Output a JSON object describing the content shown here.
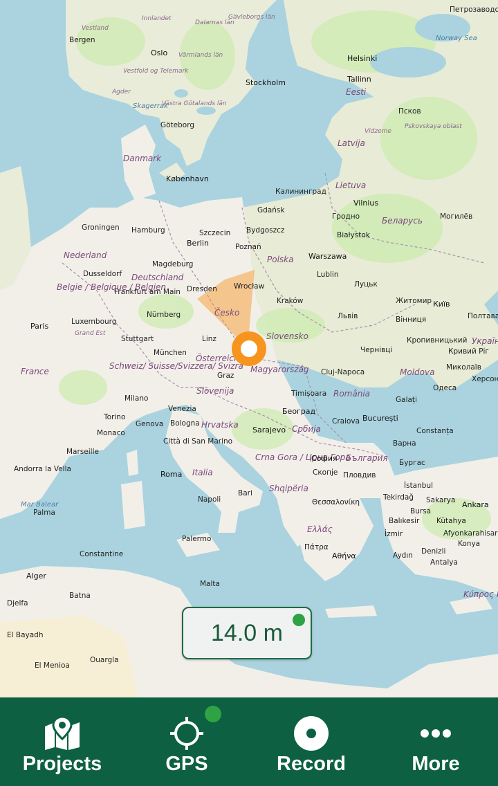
{
  "accuracy": {
    "value": "14.0 m",
    "status_color": "#2ea244"
  },
  "nav": {
    "projects": {
      "label": "Projects",
      "icon": "map-pin-icon"
    },
    "gps": {
      "label": "GPS",
      "icon": "crosshair-icon",
      "status_color": "#2ea244"
    },
    "record": {
      "label": "Record",
      "icon": "record-icon"
    },
    "more": {
      "label": "More",
      "icon": "more-dots-icon"
    }
  },
  "colors": {
    "bar": "#0d6142",
    "marker": "#f7941e",
    "water": "#aad3df",
    "land": "#f2efe9"
  },
  "map": {
    "labels": [
      {
        "t": "Петрозаводск",
        "c": "city"
      },
      {
        "t": "Vestland",
        "c": "region"
      },
      {
        "t": "Innlandet",
        "c": "region"
      },
      {
        "t": "Dalarnas län",
        "c": "region"
      },
      {
        "t": "Gävleborgs län",
        "c": "region"
      },
      {
        "t": "Bergen",
        "c": "city"
      },
      {
        "t": "Oslo",
        "c": "cap"
      },
      {
        "t": "Värmlands län",
        "c": "region"
      },
      {
        "t": "Helsinki",
        "c": "cap"
      },
      {
        "t": "Vestfold og Telemark",
        "c": "region"
      },
      {
        "t": "Stockholm",
        "c": "cap"
      },
      {
        "t": "Tallinn",
        "c": "cap"
      },
      {
        "t": "Agder",
        "c": "region"
      },
      {
        "t": "Eesti",
        "c": "country"
      },
      {
        "t": "Skagerrak",
        "c": "sea"
      },
      {
        "t": "Västra Götalands län",
        "c": "region"
      },
      {
        "t": "Псков",
        "c": "city"
      },
      {
        "t": "Göteborg",
        "c": "city"
      },
      {
        "t": "Vidzeme",
        "c": "region"
      },
      {
        "t": "Latvija",
        "c": "country"
      },
      {
        "t": "Danmark",
        "c": "country"
      },
      {
        "t": "København",
        "c": "cap"
      },
      {
        "t": "Lietuva",
        "c": "country"
      },
      {
        "t": "Калининград",
        "c": "city"
      },
      {
        "t": "Vilnius",
        "c": "cap"
      },
      {
        "t": "Gdańsk",
        "c": "city"
      },
      {
        "t": "Groningen",
        "c": "city"
      },
      {
        "t": "Hamburg",
        "c": "city"
      },
      {
        "t": "Szczecin",
        "c": "city"
      },
      {
        "t": "Bydgoszcz",
        "c": "city"
      },
      {
        "t": "Гродно",
        "c": "city"
      },
      {
        "t": "Беларусь",
        "c": "country"
      },
      {
        "t": "Могилёв",
        "c": "city"
      },
      {
        "t": "Berlin",
        "c": "cap"
      },
      {
        "t": "Poznań",
        "c": "city"
      },
      {
        "t": "Białystok",
        "c": "city"
      },
      {
        "t": "Nederland",
        "c": "country"
      },
      {
        "t": "Magdeburg",
        "c": "city"
      },
      {
        "t": "Polska",
        "c": "country"
      },
      {
        "t": "Warszawa",
        "c": "cap"
      },
      {
        "t": "Dusseldorf",
        "c": "city"
      },
      {
        "t": "Deutschland",
        "c": "country"
      },
      {
        "t": "Lublin",
        "c": "city"
      },
      {
        "t": "Belgie / Belgique / Belgien",
        "c": "country"
      },
      {
        "t": "Frankfurt am Main",
        "c": "city"
      },
      {
        "t": "Dresden",
        "c": "city"
      },
      {
        "t": "Wrocław",
        "c": "city"
      },
      {
        "t": "Луцьк",
        "c": "city"
      },
      {
        "t": "Житомир",
        "c": "city"
      },
      {
        "t": "Київ",
        "c": "cap"
      },
      {
        "t": "Česko",
        "c": "country"
      },
      {
        "t": "Kraków",
        "c": "city"
      },
      {
        "t": "Nürnberg",
        "c": "city"
      },
      {
        "t": "Львів",
        "c": "city"
      },
      {
        "t": "Вінниця",
        "c": "city"
      },
      {
        "t": "Полтава",
        "c": "city"
      },
      {
        "t": "Luxembourg",
        "c": "city"
      },
      {
        "t": "Paris",
        "c": "cap"
      },
      {
        "t": "Grand Est",
        "c": "region"
      },
      {
        "t": "Stuttgart",
        "c": "city"
      },
      {
        "t": "Linz",
        "c": "city"
      },
      {
        "t": "Slovensko",
        "c": "country"
      },
      {
        "t": "Кропивницький",
        "c": "city"
      },
      {
        "t": "Україна",
        "c": "country"
      },
      {
        "t": "Чернівці",
        "c": "city"
      },
      {
        "t": "Кривий Ріг",
        "c": "city"
      },
      {
        "t": "München",
        "c": "city"
      },
      {
        "t": "Österreich",
        "c": "country"
      },
      {
        "t": "Magyarország",
        "c": "country"
      },
      {
        "t": "Миколаїв",
        "c": "city"
      },
      {
        "t": "Херсон",
        "c": "city"
      },
      {
        "t": "France",
        "c": "country"
      },
      {
        "t": "Schweiz/ Suisse/Svizzera/ Svizra",
        "c": "country"
      },
      {
        "t": "Graz",
        "c": "city"
      },
      {
        "t": "Cluj-Napoca",
        "c": "city"
      },
      {
        "t": "Moldova",
        "c": "country"
      },
      {
        "t": "Одеса",
        "c": "city"
      },
      {
        "t": "Slovenija",
        "c": "country"
      },
      {
        "t": "Timișoara",
        "c": "city"
      },
      {
        "t": "România",
        "c": "country"
      },
      {
        "t": "Milano",
        "c": "city"
      },
      {
        "t": "Galați",
        "c": "city"
      },
      {
        "t": "Venezia",
        "c": "city"
      },
      {
        "t": "Torino",
        "c": "city"
      },
      {
        "t": "Genova",
        "c": "city"
      },
      {
        "t": "Bologna",
        "c": "city"
      },
      {
        "t": "Hrvatska",
        "c": "country"
      },
      {
        "t": "Београд",
        "c": "cap"
      },
      {
        "t": "Craiova",
        "c": "city"
      },
      {
        "t": "București",
        "c": "cap"
      },
      {
        "t": "Constanța",
        "c": "city"
      },
      {
        "t": "Monaco",
        "c": "city"
      },
      {
        "t": "Città di San Marino",
        "c": "city"
      },
      {
        "t": "Sarajevo",
        "c": "cap"
      },
      {
        "t": "Србија",
        "c": "country"
      },
      {
        "t": "Варна",
        "c": "city"
      },
      {
        "t": "Marseille",
        "c": "city"
      },
      {
        "t": "Crna Gora / Црна Гора",
        "c": "country"
      },
      {
        "t": "София",
        "c": "cap"
      },
      {
        "t": "България",
        "c": "country"
      },
      {
        "t": "Бургас",
        "c": "city"
      },
      {
        "t": "Andorra la Vella",
        "c": "city"
      },
      {
        "t": "Roma",
        "c": "cap"
      },
      {
        "t": "Italia",
        "c": "country"
      },
      {
        "t": "Скопје",
        "c": "city"
      },
      {
        "t": "Пловдив",
        "c": "city"
      },
      {
        "t": "Mar Balear",
        "c": "sea"
      },
      {
        "t": "Palma",
        "c": "city"
      },
      {
        "t": "Bari",
        "c": "city"
      },
      {
        "t": "Shqipëria",
        "c": "country"
      },
      {
        "t": "İstanbul",
        "c": "city"
      },
      {
        "t": "Tekirdağ",
        "c": "city"
      },
      {
        "t": "Sakarya",
        "c": "city"
      },
      {
        "t": "Napoli",
        "c": "city"
      },
      {
        "t": "Θεσσαλονίκη",
        "c": "city"
      },
      {
        "t": "Ankara",
        "c": "cap"
      },
      {
        "t": "Bursa",
        "c": "city"
      },
      {
        "t": "Balıkesir",
        "c": "city"
      },
      {
        "t": "Kütahya",
        "c": "city"
      },
      {
        "t": "Ελλάς",
        "c": "country"
      },
      {
        "t": "İzmir",
        "c": "city"
      },
      {
        "t": "Afyonkarahisar",
        "c": "city"
      },
      {
        "t": "Palermo",
        "c": "city"
      },
      {
        "t": "Πάτρα",
        "c": "city"
      },
      {
        "t": "Αθήνα",
        "c": "cap"
      },
      {
        "t": "Konya",
        "c": "city"
      },
      {
        "t": "Constantine",
        "c": "city"
      },
      {
        "t": "Aydın",
        "c": "city"
      },
      {
        "t": "Denizli",
        "c": "city"
      },
      {
        "t": "Alger",
        "c": "cap"
      },
      {
        "t": "Antalya",
        "c": "city"
      },
      {
        "t": "Malta",
        "c": "city"
      },
      {
        "t": "Batna",
        "c": "city"
      },
      {
        "t": "Djelfa",
        "c": "city"
      },
      {
        "t": "El Bayadh",
        "c": "city"
      },
      {
        "t": "El Menioa",
        "c": "city"
      },
      {
        "t": "Ouargla",
        "c": "city"
      },
      {
        "t": "Κύπρος Kıbrıs",
        "c": "country"
      },
      {
        "t": "Pskovskaya oblast",
        "c": "region"
      },
      {
        "t": "Norway Sea",
        "c": "sea"
      }
    ]
  }
}
